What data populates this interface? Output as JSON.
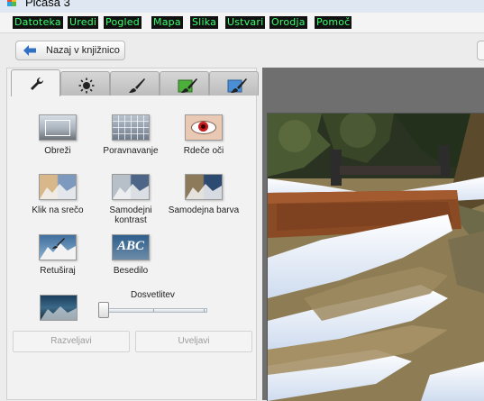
{
  "window": {
    "title": "Picasa 3"
  },
  "menu": [
    "Datoteka",
    "Uredi",
    "Pogled",
    "Mapa",
    "Slika",
    "Ustvari",
    "Orodja",
    "Pomoč"
  ],
  "toolbar": {
    "back_label": "Nazaj v knjižnico"
  },
  "tabs": [
    {
      "icon": "wrench-icon",
      "active": true
    },
    {
      "icon": "sun-icon",
      "active": false
    },
    {
      "icon": "brush-icon",
      "active": false
    },
    {
      "icon": "green-brush-icon",
      "active": false
    },
    {
      "icon": "blue-brush-icon",
      "active": false
    }
  ],
  "tools": [
    {
      "label": "Obreži"
    },
    {
      "label": "Poravnavanje"
    },
    {
      "label": "Rdeče oči"
    },
    {
      "label": "Klik na srečo"
    },
    {
      "label": "Samodejni kontrast"
    },
    {
      "label": "Samodejna barva"
    },
    {
      "label": "Retuširaj"
    },
    {
      "label": "Besedilo",
      "thumb_text": "ABC"
    }
  ],
  "brightness": {
    "label": "Dosvetlitev",
    "level": 0.0
  },
  "buttons": {
    "undo": "Razveljavi",
    "redo": "Uveljavi"
  },
  "colors": {
    "menu_text": "#39ff6e",
    "panel_bg": "#f2f2f2",
    "viewer_bg": "#6f6f6f"
  }
}
